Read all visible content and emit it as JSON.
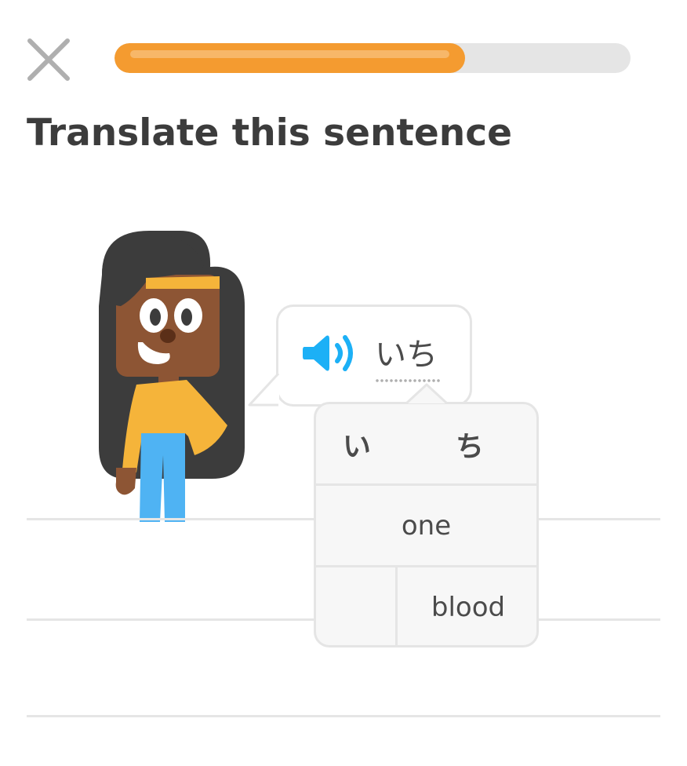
{
  "progress": {
    "fraction": 0.68,
    "fill_color": "#f49b30",
    "track_color": "#e5e5e5"
  },
  "close_icon": "close-x-icon",
  "header": {
    "title": "Translate this sentence"
  },
  "prompt": {
    "speaker_icon": "speaker-icon",
    "text": "いち"
  },
  "hint": {
    "characters": [
      "い",
      "ち"
    ],
    "meanings": [
      {
        "label": "one"
      },
      {
        "label": "blood"
      }
    ]
  },
  "colors": {
    "speaker": "#1cb0f6",
    "text": "#4b4b4b",
    "title": "#3c3c3c",
    "border": "#e5e5e5"
  }
}
